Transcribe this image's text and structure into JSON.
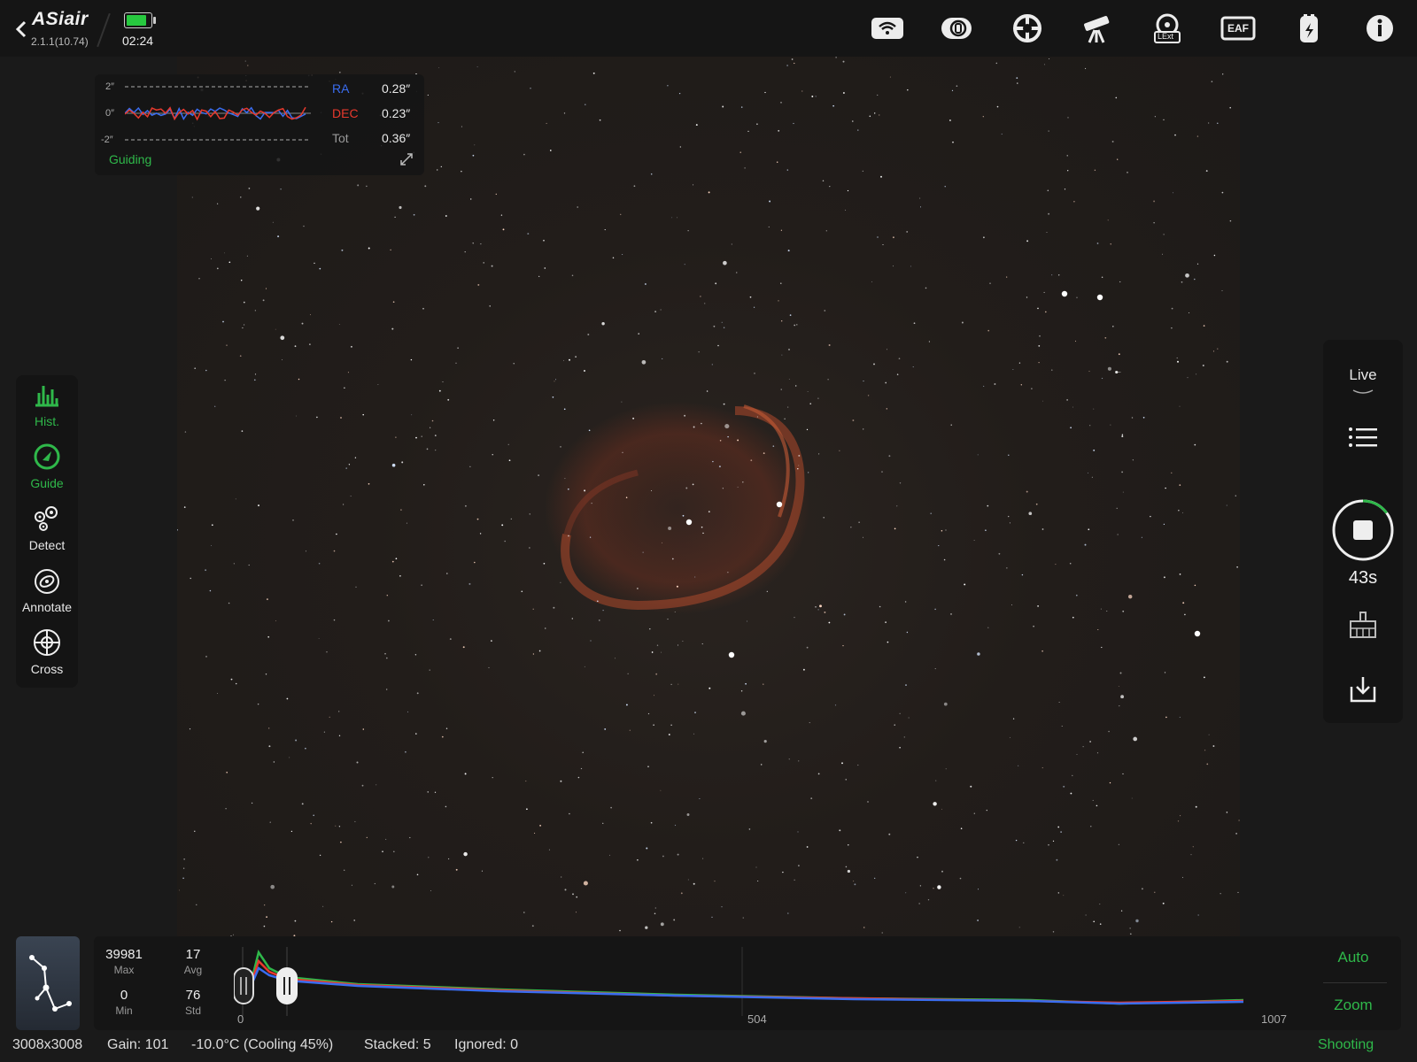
{
  "app": {
    "name": "ASiair",
    "version": "2.1.1(10.74)",
    "clock": "02:24",
    "battery_level": 0.85
  },
  "toolbar": {
    "icons": [
      "wifi-icon",
      "filter-wheel-icon",
      "mount-target-icon",
      "telescope-icon",
      "lext-icon",
      "eaf-icon",
      "power-usb-icon",
      "info-icon"
    ],
    "lext_label": "LExt",
    "eaf_label": "EAF"
  },
  "guiding": {
    "ticks": [
      "2″",
      "0″",
      "-2″"
    ],
    "ra_label": "RA",
    "ra_value": "0.28″",
    "dec_label": "DEC",
    "dec_value": "0.23″",
    "tot_label": "Tot",
    "tot_value": "0.36″",
    "status": "Guiding",
    "ra_color": "#3a6df0",
    "dec_color": "#e8392d"
  },
  "left_tools": [
    {
      "label": "Hist.",
      "active": true
    },
    {
      "label": "Guide",
      "active": true
    },
    {
      "label": "Detect",
      "active": false
    },
    {
      "label": "Annotate",
      "active": false
    },
    {
      "label": "Cross",
      "active": false
    }
  ],
  "right_panel": {
    "mode": "Live",
    "timer": "43s",
    "timer_progress": 0.15
  },
  "histogram": {
    "max": "39981",
    "max_label": "Max",
    "min": "0",
    "min_label": "Min",
    "avg": "17",
    "avg_label": "Avg",
    "std": "76",
    "std_label": "Std",
    "axis": [
      "0",
      "504",
      "1007"
    ],
    "auto_label": "Auto",
    "zoom_label": "Zoom"
  },
  "status_bar": {
    "resolution": "3008x3008",
    "gain": "Gain: 101",
    "temperature": "-10.0°C (Cooling 45%)",
    "stacked": "Stacked: 5",
    "ignored": "Ignored: 0",
    "state": "Shooting"
  },
  "colors": {
    "accent": "#2fb84a",
    "background": "#1a1a1a"
  }
}
